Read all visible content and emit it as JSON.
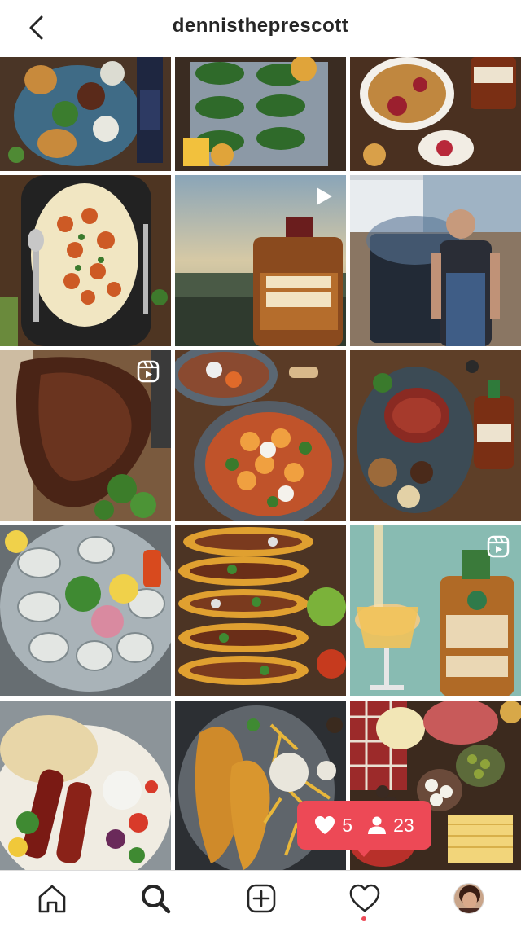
{
  "header": {
    "username": "dennistheprescott"
  },
  "grid": {
    "posts": [
      {
        "id": "post-1",
        "subject": "burger-and-dips-platter",
        "badge": ""
      },
      {
        "id": "post-2",
        "subject": "grilled-crostini-tray",
        "badge": ""
      },
      {
        "id": "post-3",
        "subject": "fruit-crumble-with-bourbon",
        "badge": ""
      },
      {
        "id": "post-4",
        "subject": "shrimp-and-grits",
        "badge": ""
      },
      {
        "id": "post-5",
        "subject": "jeffersons-ocean-bottle",
        "badge": "play-icon"
      },
      {
        "id": "post-6",
        "subject": "chef-at-smoker-grill",
        "badge": ""
      },
      {
        "id": "post-7",
        "subject": "grilled-ribeye-steak",
        "badge": "reels-icon"
      },
      {
        "id": "post-8",
        "subject": "gnocchi-with-burrata",
        "badge": ""
      },
      {
        "id": "post-9",
        "subject": "steak-dinner-with-bourbon",
        "badge": ""
      },
      {
        "id": "post-10",
        "subject": "oysters-on-ice",
        "badge": ""
      },
      {
        "id": "post-11",
        "subject": "tacos-with-guacamole",
        "badge": ""
      },
      {
        "id": "post-12",
        "subject": "cognac-cocktail-jeffersons",
        "badge": "reels-icon"
      },
      {
        "id": "post-13",
        "subject": "kebabs-with-flatbread",
        "badge": ""
      },
      {
        "id": "post-14",
        "subject": "fish-and-chips",
        "badge": ""
      },
      {
        "id": "post-15",
        "subject": "charcuterie-board",
        "badge": ""
      }
    ]
  },
  "activity": {
    "likes": "5",
    "followers": "23"
  },
  "nav": {
    "items": [
      "home-icon",
      "search-icon",
      "create-icon",
      "activity-icon",
      "profile-avatar"
    ]
  },
  "colors": {
    "accent": "#ed4956",
    "text": "#262626",
    "divider": "#dbdbdb"
  }
}
